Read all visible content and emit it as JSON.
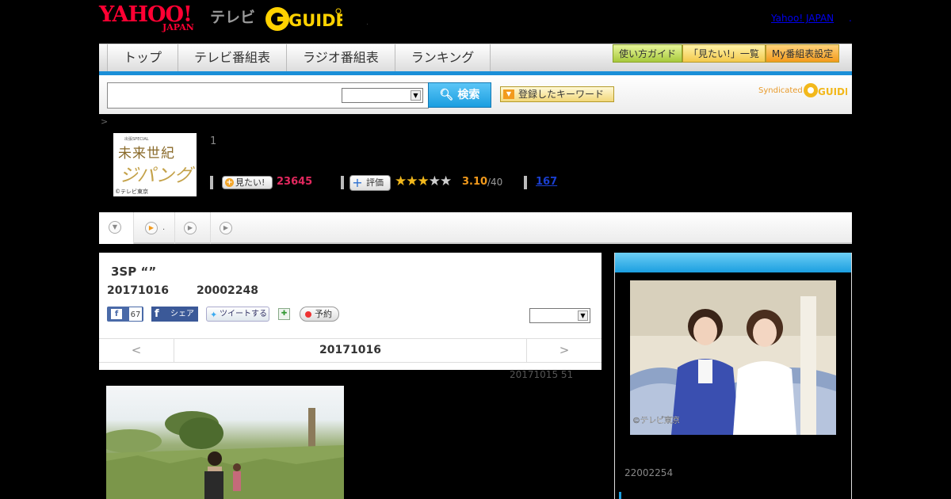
{
  "header": {
    "logo_main": "YAHOO!",
    "logo_sub": "JAPAN",
    "logo_service": "テレビ",
    "logo_partner": "G-GUIDE",
    "dot": ".",
    "yahoo_japan_link": "Yahoo! JAPAN",
    "link_dot": "."
  },
  "nav": {
    "tabs": [
      {
        "label": "トップ"
      },
      {
        "label": "テレビ番組表"
      },
      {
        "label": "ラジオ番組表"
      },
      {
        "label": "ランキング"
      }
    ],
    "buttons": [
      {
        "label": "使い方ガイド"
      },
      {
        "label": "「見たい!」一覧"
      },
      {
        "label": "My番組表設定"
      }
    ]
  },
  "search": {
    "placeholder": "",
    "button_label": "検索",
    "keyword_button": "登録したキーワード",
    "syndicated": "Syndicated",
    "syndicated_brand": "G-GUIDE"
  },
  "breadcrumb": ">",
  "program": {
    "thumb_small": "出張SPECIAL",
    "thumb_title_1": "未来世紀",
    "thumb_title_2": "ジパング",
    "thumb_copyright": "©テレビ東京",
    "number": "1",
    "mitai_label": "見たい!",
    "mitai_count": "23645",
    "hyoka_label": "評価",
    "rating": 3,
    "score": "3.10",
    "score_max": "/40",
    "review_count": "167"
  },
  "tabbar": {
    "dot": "."
  },
  "episode": {
    "title": "3SP “”",
    "date": "20171016",
    "id": "20002248",
    "fb_like_count": "67",
    "fb_share": "シェア",
    "tweet": "ツイートする",
    "reserve": "予約",
    "pager_prev": "<",
    "pager_date": "20171016",
    "pager_next": ">",
    "pub_date": "20171015  51"
  },
  "sidebar": {
    "image_copyright": "©テレビ東京",
    "id": "22002254"
  },
  "colors": {
    "accent_blue": "#1a8fd8",
    "yahoo_red": "#ff0033",
    "mitai_pink": "#e2285e",
    "star_gold": "#f2b81c"
  }
}
